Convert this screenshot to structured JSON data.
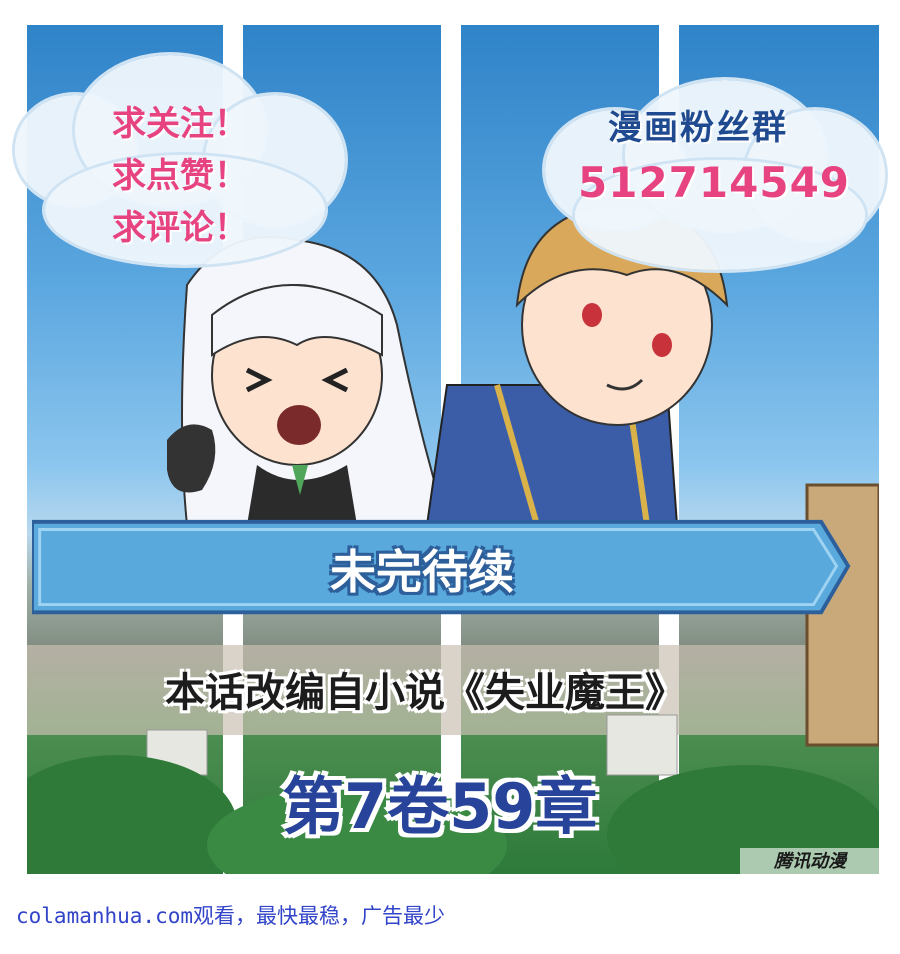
{
  "bubble_left": {
    "lines": [
      "求关注！",
      "求点赞！",
      "求评论！"
    ]
  },
  "bubble_right": {
    "title": "漫画粉丝群",
    "number": "512714549"
  },
  "banner": {
    "label": "未完待续"
  },
  "source": {
    "text": "本话改编自小说《失业魔王》"
  },
  "chapter": {
    "text": "第7卷59章"
  },
  "watermark": {
    "text": "腾讯动漫"
  },
  "footer": {
    "text": "colamanhua.com观看，最快最稳，广告最少"
  },
  "colors": {
    "pink": "#e64380",
    "navy": "#1f4a8f",
    "chapter_blue": "#27449a",
    "banner_blue": "#5aa9dd",
    "footer_link": "#3244c8"
  }
}
